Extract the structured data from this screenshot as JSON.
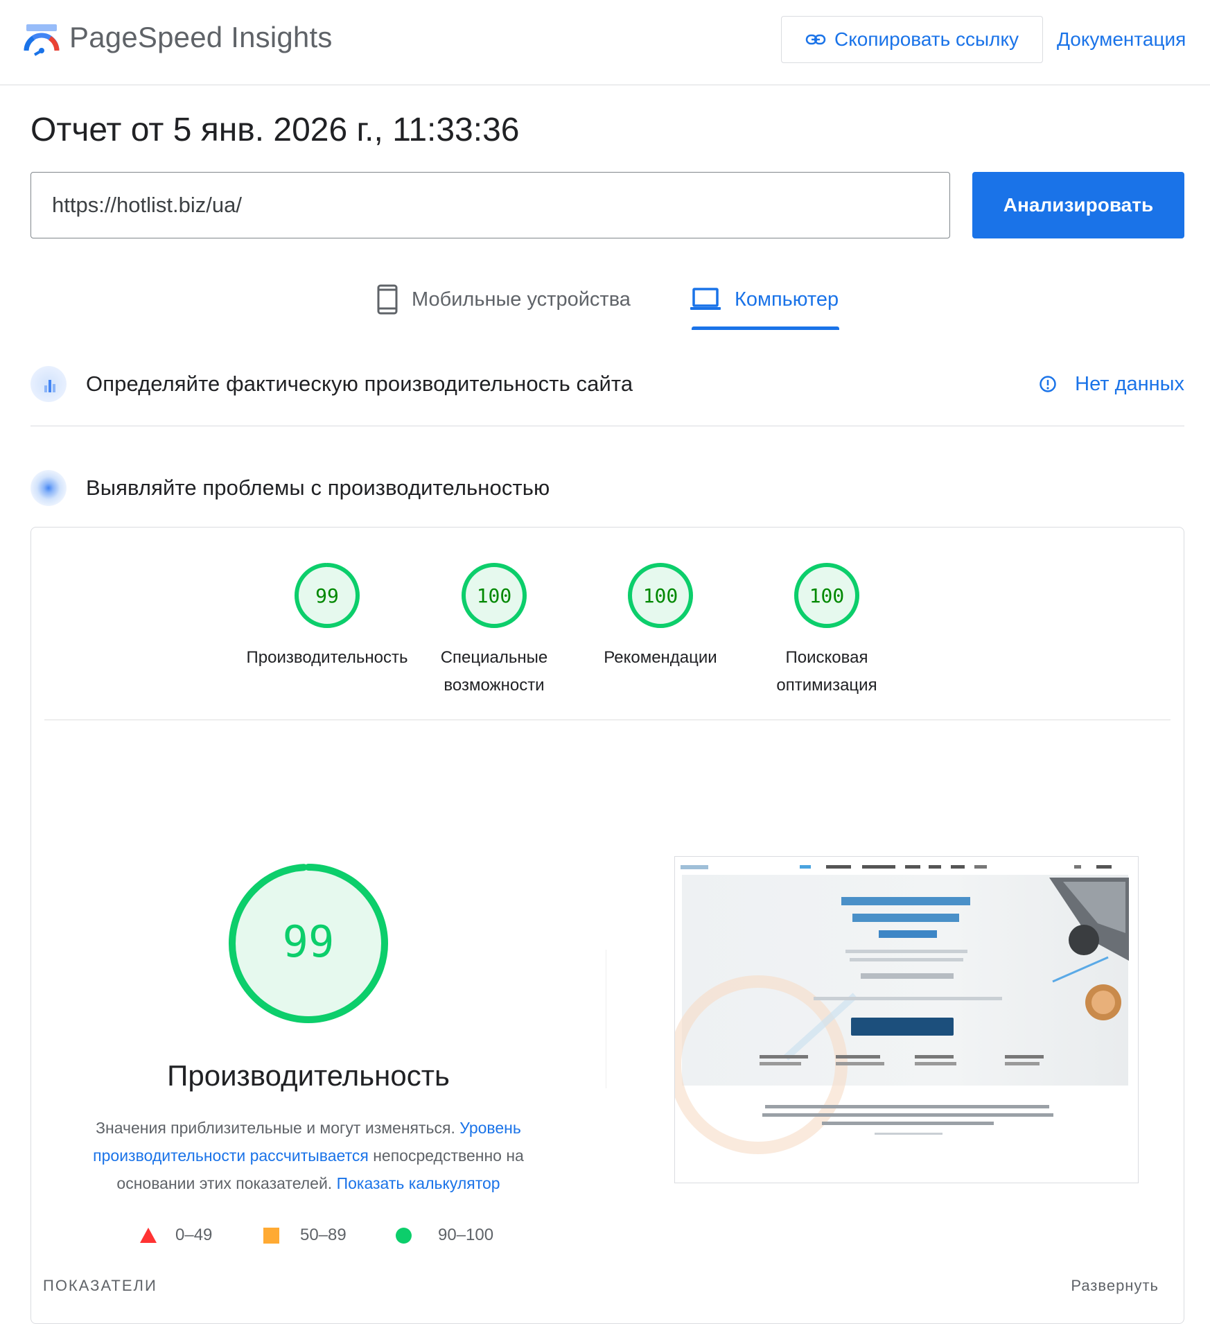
{
  "header": {
    "app_title": "PageSpeed Insights",
    "copy_link_label": "Скопировать ссылку",
    "docs_label": "Документация"
  },
  "report": {
    "title": "Отчет от 5 янв. 2026 г., 11:33:36",
    "url_value": "https://hotlist.biz/ua/",
    "analyze_label": "Анализировать"
  },
  "tabs": [
    {
      "label": "Мобильные устройства",
      "active": false,
      "icon": "phone-icon"
    },
    {
      "label": "Компьютер",
      "active": true,
      "icon": "laptop-icon"
    }
  ],
  "field_section": {
    "title": "Определяйте фактическую производительность сайта",
    "status_label": "Нет данных"
  },
  "lab_section": {
    "title": "Выявляйте проблемы с производительностью"
  },
  "scores": [
    {
      "value": 99,
      "label_line1": "Производительность",
      "label_line2": ""
    },
    {
      "value": 100,
      "label_line1": "Специальные",
      "label_line2": "возможности"
    },
    {
      "value": 100,
      "label_line1": "Рекомендации",
      "label_line2": ""
    },
    {
      "value": 100,
      "label_line1": "Поисковая",
      "label_line2": "оптимизация"
    }
  ],
  "performance": {
    "score": 99,
    "title": "Производительность",
    "desc_text1": "Значения приблизительные и могут изменяться. ",
    "desc_link1": "Уровень производительности рассчитывается",
    "desc_text2": " непосредственно на основании этих показателей. ",
    "desc_link2": "Показать калькулятор"
  },
  "legend": [
    {
      "range": "0–49",
      "shape": "triangle",
      "color": "#ff3333"
    },
    {
      "range": "50–89",
      "shape": "square",
      "color": "#ffaa33"
    },
    {
      "range": "90–100",
      "shape": "circle",
      "color": "#0cce6b"
    }
  ],
  "footer": {
    "metrics_label": "ПОКАЗАТЕЛИ",
    "expand_label": "Развернуть"
  },
  "colors": {
    "accent": "#1a73e8",
    "pass": "#0cce6b",
    "pass_text": "#008800",
    "pass_fill": "#e6f9ee"
  }
}
